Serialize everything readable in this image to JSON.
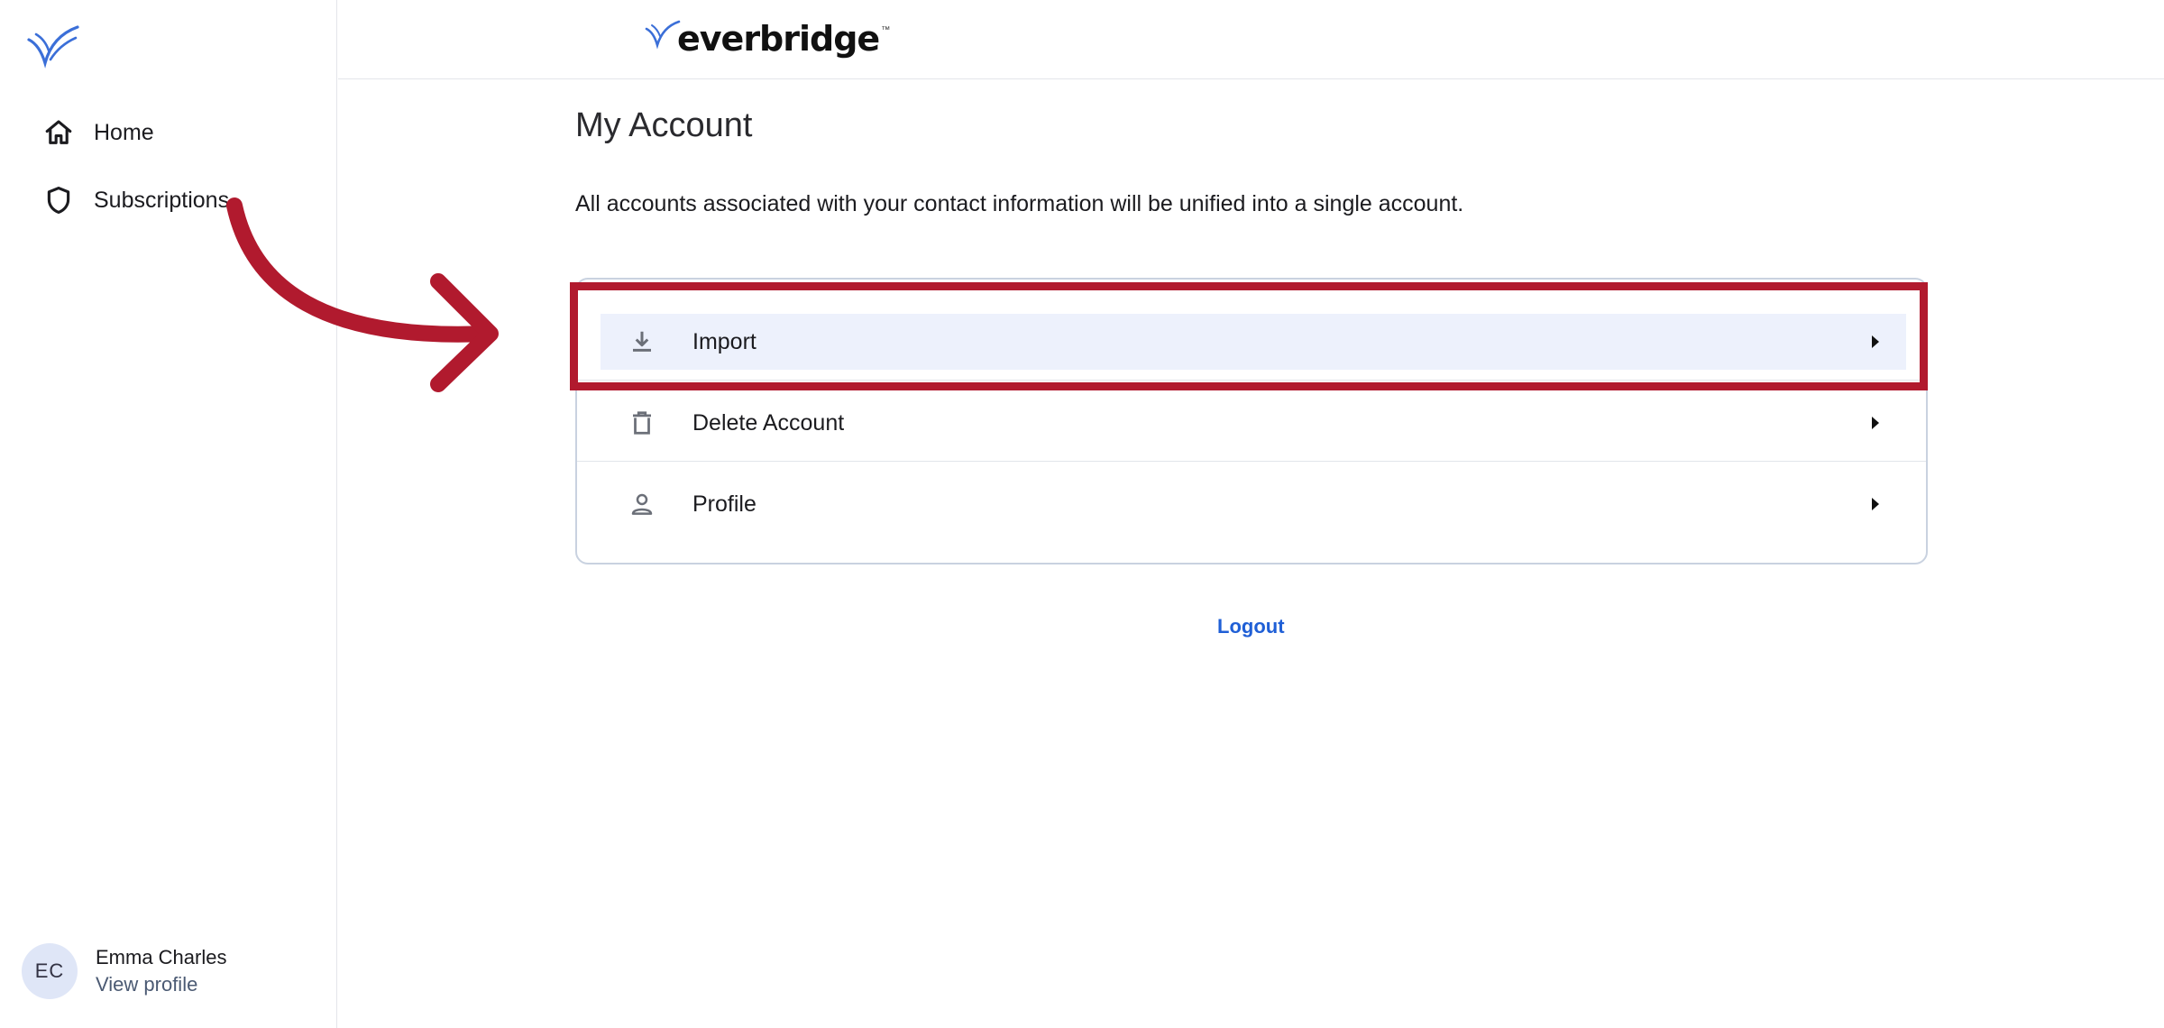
{
  "sidebar": {
    "logo_icon": "everbridge-check-mark-icon",
    "items": [
      {
        "label": "Home",
        "icon": "home-icon"
      },
      {
        "label": "Subscriptions",
        "icon": "shield-icon"
      }
    ],
    "user": {
      "initials": "EC",
      "name": "Emma Charles",
      "link": "View profile"
    }
  },
  "header": {
    "brand": "everbridge",
    "trademark": "™"
  },
  "main": {
    "title": "My Account",
    "description": "All accounts associated with your contact information will be unified into a single account.",
    "options": [
      {
        "label": "Import",
        "icon": "download-icon",
        "highlighted": true
      },
      {
        "label": "Delete Account",
        "icon": "trash-icon"
      },
      {
        "label": "Profile",
        "icon": "person-icon"
      }
    ],
    "logout_label": "Logout"
  },
  "colors": {
    "accent": "#1f5fd6",
    "annotation": "#b11a2e",
    "row_highlight": "#edf1fc"
  }
}
